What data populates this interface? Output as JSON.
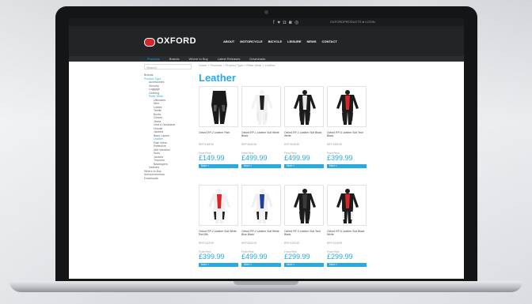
{
  "topbar": {
    "social": "f ♥ ◘ ◙ ◎",
    "util": "OXFORDPRODUCTS ● LOGIN"
  },
  "brand": {
    "name": "OXFORD"
  },
  "nav": [
    "ABOUT",
    "MOTORCYCLE",
    "BICYCLE",
    "LEISURE",
    "NEWS",
    "CONTACT"
  ],
  "subnav": {
    "items": [
      "Products",
      "Brands",
      "Where to Buy",
      "Latest Releases",
      "Downloads"
    ]
  },
  "sidebar": {
    "search_placeholder": "Search",
    "items": [
      {
        "label": "Brands",
        "level": 0
      },
      {
        "label": "Product Type",
        "level": 0,
        "active": true
      },
      {
        "label": "Accessories",
        "level": 1
      },
      {
        "label": "Security",
        "level": 1
      },
      {
        "label": "Luggage",
        "level": 1
      },
      {
        "label": "Clothing",
        "level": 1
      },
      {
        "label": "Rider Wear",
        "level": 1,
        "active": true
      },
      {
        "label": "Ultimates",
        "level": 2
      },
      {
        "label": "Men",
        "level": 2
      },
      {
        "label": "Ladies",
        "level": 2
      },
      {
        "label": "Textile",
        "level": 2
      },
      {
        "label": "Boots",
        "level": 2
      },
      {
        "label": "Gloves",
        "level": 2
      },
      {
        "label": "Jeans",
        "level": 2
      },
      {
        "label": "Vest & Neckwear",
        "level": 2
      },
      {
        "label": "Hoodie",
        "level": 2
      },
      {
        "label": "Jackets",
        "level": 2
      },
      {
        "label": "Base Layers",
        "level": 2
      },
      {
        "label": "Leather",
        "level": 2,
        "active": true
      },
      {
        "label": "Rain Wear",
        "level": 2
      },
      {
        "label": "Reflective",
        "level": 2
      },
      {
        "label": "Wet Weather",
        "level": 2
      },
      {
        "label": "Suits",
        "level": 2
      },
      {
        "label": "Jackets",
        "level": 2
      },
      {
        "label": "Trousers",
        "level": 2
      },
      {
        "label": "Baselayers",
        "level": 2
      },
      {
        "label": "Helmets",
        "level": 1
      },
      {
        "label": "Where to Buy",
        "level": 0
      },
      {
        "label": "Announcements",
        "level": 0
      },
      {
        "label": "Downloads",
        "level": 0
      }
    ]
  },
  "breadcrumb": "Home > Products > Product Type > Rider Wear > Leather",
  "page_title": "Leather",
  "products": [
    {
      "name": "Oxford RP-2 Leather Pant",
      "rrp": "RRP £169.99",
      "from_label": "From Price",
      "price": "£149.99",
      "more": "More »",
      "colors": [
        "#1a1a1a",
        "#1a1a1a",
        "#1a1a1a"
      ]
    },
    {
      "name": "Oxford RP-1 Leather Suit White Black",
      "rrp": "RRP £549.99",
      "from_label": "From Price",
      "price": "£499.99",
      "more": "More »",
      "colors": [
        "#f2f2f2",
        "#222222",
        "#e8e8e8"
      ]
    },
    {
      "name": "Oxford RP-1 Leather Suit Black White",
      "rrp": "RRP £549.99",
      "from_label": "From Price",
      "price": "£499.99",
      "more": "More »",
      "colors": [
        "#1c1c1c",
        "#e6e6e6",
        "#1c1c1c"
      ]
    },
    {
      "name": "Oxford RP-6 Leather Suit Tech Black",
      "rrp": "RRP £399.99",
      "from_label": "From Price",
      "price": "£399.99",
      "more": "More »",
      "colors": [
        "#1c1c1c",
        "#d6262b",
        "#1c1c1c"
      ]
    },
    {
      "name": "Oxford RP-2 Leather Suit White Red Blk",
      "rrp": "RRP £429.99",
      "from_label": "From Price",
      "price": "£399.99",
      "more": "More »",
      "colors": [
        "#f0f0f0",
        "#d6262b",
        "#222222"
      ]
    },
    {
      "name": "Oxford RP-2 Leather Suit White Blue Black",
      "rrp": "RRP £549.99",
      "from_label": "From Price",
      "price": "£499.99",
      "more": "More »",
      "colors": [
        "#f0f0f0",
        "#1f3f9a",
        "#222222"
      ]
    },
    {
      "name": "Oxford RP-3 Leather Suit Tech Black",
      "rrp": "RRP £299.99",
      "from_label": "From Price",
      "price": "£299.99",
      "more": "More »",
      "colors": [
        "#1c1c1c",
        "#3a3a3a",
        "#1c1c1c"
      ]
    },
    {
      "name": "Oxford RP-6 Leather Suit Black White",
      "rrp": "RRP £349.99",
      "from_label": "From Price",
      "price": "£299.99",
      "more": "More »",
      "colors": [
        "#1c1c1c",
        "#d6262b",
        "#e6e6e6"
      ]
    }
  ],
  "accent": "#29a9e1",
  "brand_red": "#d6262b"
}
